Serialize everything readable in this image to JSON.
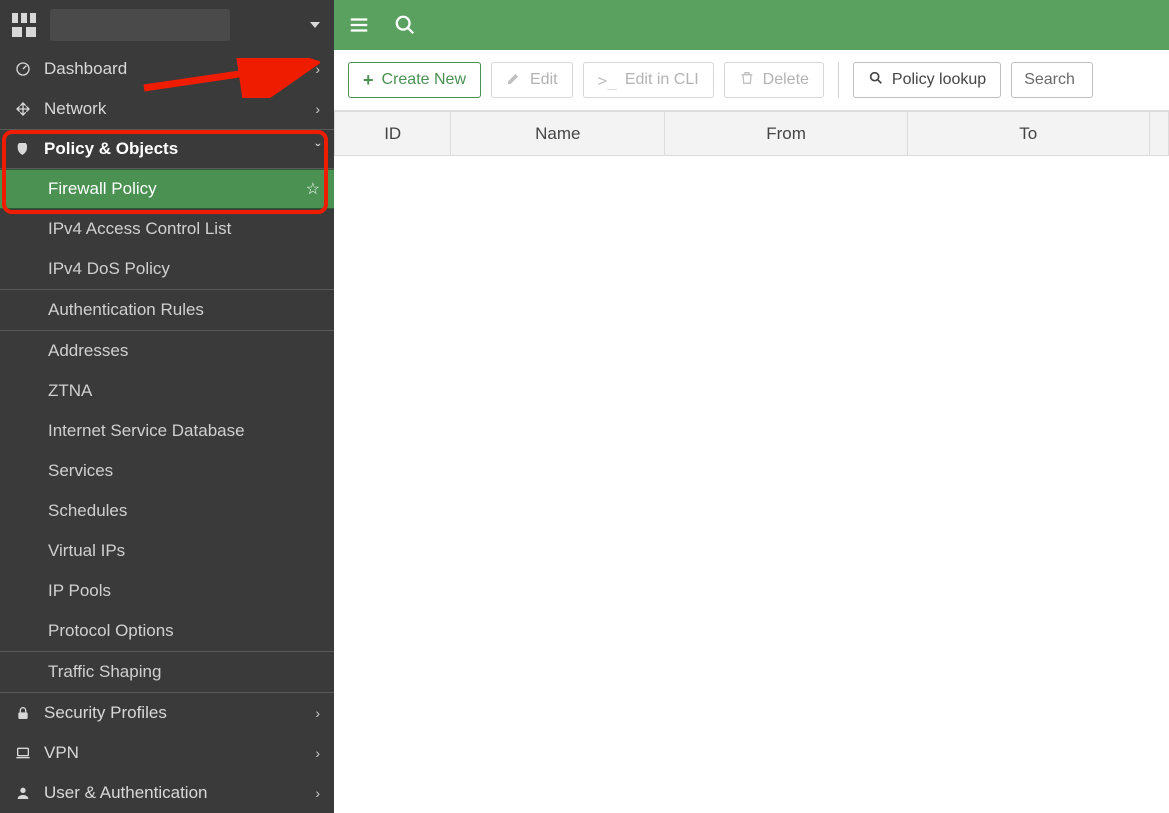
{
  "sidebar": {
    "items": [
      {
        "icon": "gauge-icon",
        "label": "Dashboard",
        "chev": "›"
      },
      {
        "icon": "move-icon",
        "label": "Network",
        "chev": "›"
      },
      {
        "icon": "shield-icon",
        "label": "Policy & Objects",
        "chev": "ˇ",
        "expanded": true
      },
      {
        "icon": "lock-icon",
        "label": "Security Profiles",
        "chev": "›"
      },
      {
        "icon": "laptop-icon",
        "label": "VPN",
        "chev": "›"
      },
      {
        "icon": "user-icon",
        "label": "User & Authentication",
        "chev": "›"
      }
    ],
    "policy_sub": [
      "Firewall Policy",
      "IPv4 Access Control List",
      "IPv4 DoS Policy",
      "Authentication Rules",
      "Addresses",
      "ZTNA",
      "Internet Service Database",
      "Services",
      "Schedules",
      "Virtual IPs",
      "IP Pools",
      "Protocol Options",
      "Traffic Shaping"
    ]
  },
  "toolbar": {
    "create": "Create New",
    "edit": "Edit",
    "edit_cli": "Edit in CLI",
    "delete": "Delete",
    "lookup": "Policy lookup",
    "search_placeholder": "Search"
  },
  "table": {
    "cols": [
      "ID",
      "Name",
      "From",
      "To",
      ""
    ]
  }
}
